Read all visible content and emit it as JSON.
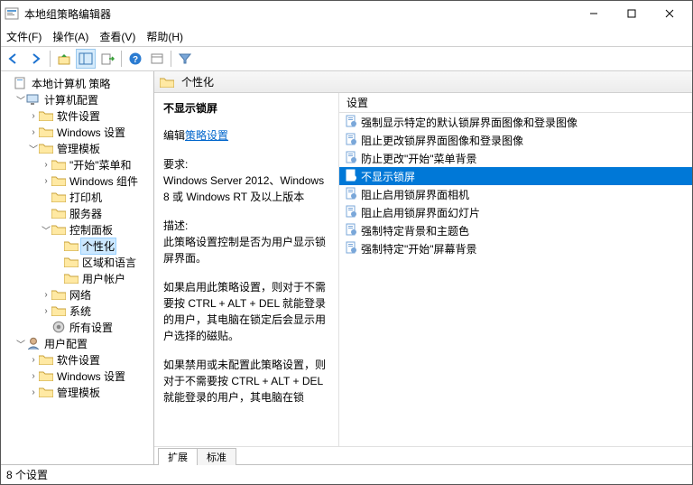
{
  "window": {
    "title": "本地组策略编辑器"
  },
  "menu": {
    "file": "文件(F)",
    "action": "操作(A)",
    "view": "查看(V)",
    "help": "帮助(H)"
  },
  "toolbar_icons": {
    "back": "back-arrow",
    "forward": "forward-arrow",
    "up": "folder-up",
    "show_hide_tree": "tree-pane",
    "export": "export-list",
    "help": "help",
    "props": "properties",
    "filter": "filter"
  },
  "tree": {
    "root": "本地计算机 策略",
    "computer": {
      "label": "计算机配置",
      "children": {
        "software": "软件设置",
        "windows": "Windows 设置",
        "templates": {
          "label": "管理模板",
          "start_menu": "\"开始\"菜单和",
          "components": "Windows 组件",
          "printers": "打印机",
          "servers": "服务器",
          "control_panel": {
            "label": "控制面板",
            "personalization": "个性化",
            "regional": "区域和语言",
            "user_accounts": "用户帐户"
          },
          "network": "网络",
          "system": "系统",
          "all_settings": "所有设置"
        }
      }
    },
    "user": {
      "label": "用户配置",
      "children": {
        "software": "软件设置",
        "windows": "Windows 设置",
        "templates": "管理模板"
      }
    }
  },
  "path_bar": {
    "label": "个性化"
  },
  "description": {
    "title": "不显示锁屏",
    "edit_prefix": "编辑",
    "edit_link": "策略设置",
    "req_label": "要求:",
    "req_body": "Windows Server 2012、Windows 8 或 Windows RT 及以上版本",
    "desc_label": "描述:",
    "desc_p1": "此策略设置控制是否为用户显示锁屏界面。",
    "desc_p2": "如果启用此策略设置，则对于不需要按 CTRL + ALT + DEL  就能登录的用户，其电脑在锁定后会显示用户选择的磁贴。",
    "desc_p3": "如果禁用或未配置此策略设置，则对于不需要按 CTRL + ALT + DEL 就能登录的用户，其电脑在锁"
  },
  "list": {
    "header": "设置",
    "items": [
      "强制显示特定的默认锁屏界面图像和登录图像",
      "阻止更改锁屏界面图像和登录图像",
      "防止更改\"开始\"菜单背景",
      "不显示锁屏",
      "阻止启用锁屏界面相机",
      "阻止启用锁屏界面幻灯片",
      "强制特定背景和主题色",
      "强制特定\"开始\"屏幕背景"
    ],
    "selected_index": 3
  },
  "tabs": {
    "extended": "扩展",
    "standard": "标准"
  },
  "status": {
    "count_text": "8 个设置"
  }
}
